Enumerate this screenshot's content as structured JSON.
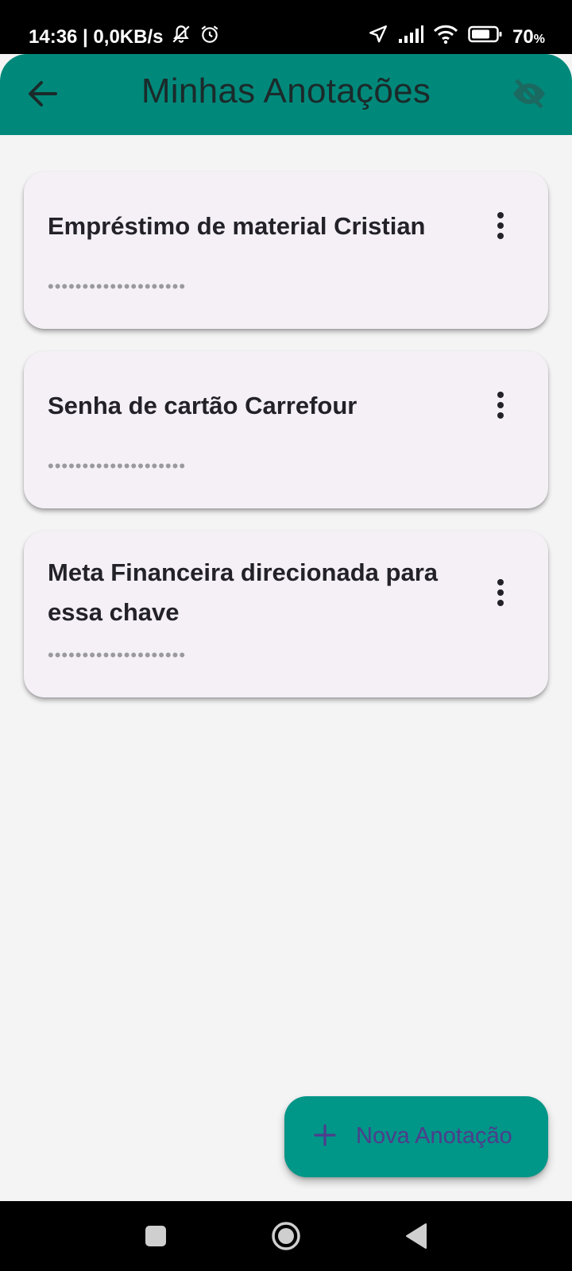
{
  "status_bar": {
    "time_speed": "14:36 | 0,0KB/s",
    "battery": "70",
    "battery_unit": "%",
    "icons": [
      "muted-bell-icon",
      "alarm-icon",
      "location-icon",
      "signal-icon",
      "wifi-icon",
      "battery-icon"
    ]
  },
  "app_bar": {
    "title": "Minhas Anotações",
    "icons": [
      "back-arrow-icon",
      "visibility-off-icon"
    ]
  },
  "notes": [
    {
      "title": "Empréstimo de material Cristian",
      "masked": "••••••••••••••••••••"
    },
    {
      "title": "Senha de cartão Carrefour",
      "masked": "••••••••••••••••••••"
    },
    {
      "title": "Meta Financeira direcionada para essa chave",
      "masked": "••••••••••••••••••••"
    }
  ],
  "fab": {
    "label": "Nova Anotação",
    "icon": "plus-icon"
  },
  "nav_bar": {
    "icons": [
      "recent-apps-icon",
      "home-icon",
      "back-icon"
    ]
  },
  "colors": {
    "app_bar": "#00897b",
    "fab": "#009688",
    "card": "#f4f0f6",
    "background": "#f4f4f4",
    "fab_label": "#4d3d8c"
  }
}
